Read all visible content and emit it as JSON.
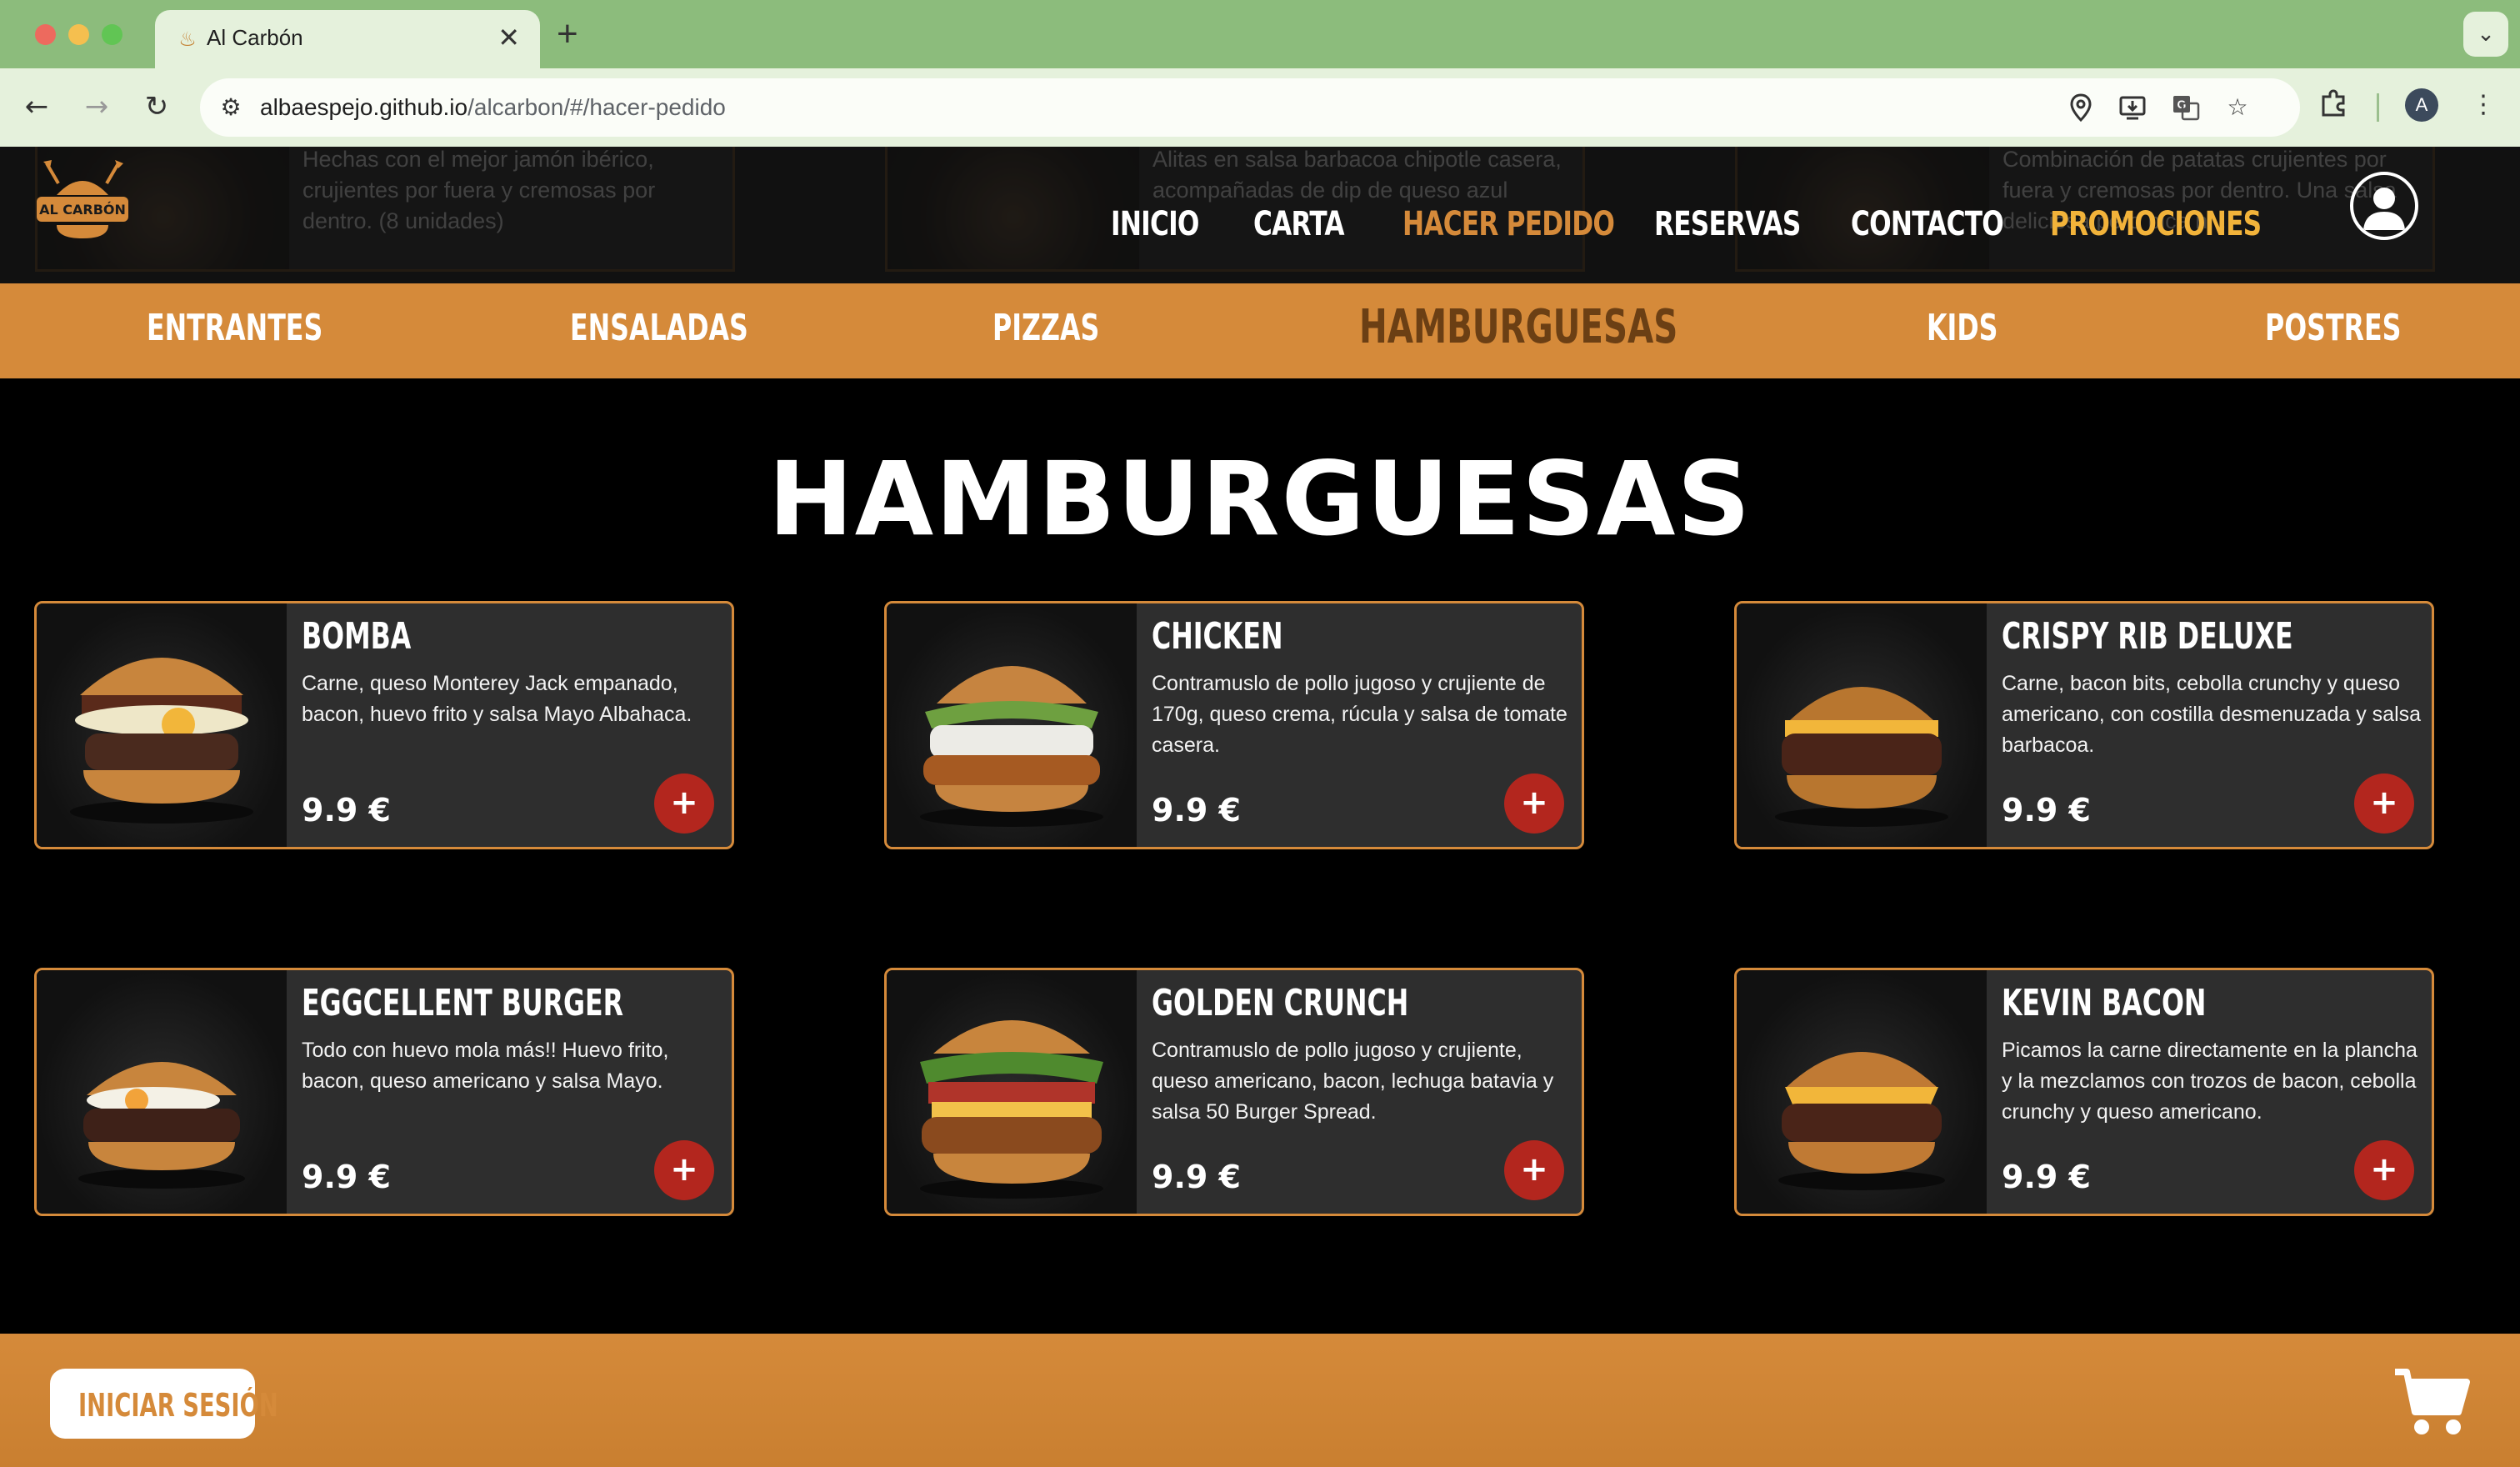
{
  "browser": {
    "tab_title": "Al Carbón",
    "url_host": "albaespejo.github.io",
    "url_path": "/alcarbon/#/hacer-pedido",
    "profile_initial": "A"
  },
  "header": {
    "ghost_cards": [
      "Hechas con el mejor jamón ibérico, crujientes por fuera y cremosas por dentro. (8 unidades)",
      "Alitas en salsa barbacoa chipotle casera, acompañadas de dip de queso azul",
      "Combinación de patatas crujientes por fuera y cremosas por dentro. Una salsa deliciosa pero pica n..."
    ],
    "nav": [
      "INICIO",
      "CARTA",
      "HACER PEDIDO",
      "RESERVAS",
      "CONTACTO",
      "PROMOCIONES"
    ],
    "logo_text": "AL CARBÓN"
  },
  "categories": [
    "ENTRANTES",
    "ENSALADAS",
    "PIZZAS",
    "HAMBURGUESAS",
    "KIDS",
    "POSTRES"
  ],
  "section_title": "HAMBURGUESAS",
  "products": [
    {
      "name": "BOMBA",
      "description": "Carne, queso Monterey Jack empanado, bacon, huevo frito y salsa Mayo Albahaca.",
      "price": "9.9 €"
    },
    {
      "name": "CHICKEN",
      "description": "Contramuslo de pollo jugoso y crujiente de 170g, queso crema, rúcula y salsa de tomate casera.",
      "price": "9.9 €"
    },
    {
      "name": "CRISPY RIB DELUXE",
      "description": "Carne, bacon bits, cebolla crunchy y queso americano, con costilla desmenuzada y salsa barbacoa.",
      "price": "9.9 €"
    },
    {
      "name": "EGGCELLENT BURGER",
      "description": "Todo con huevo mola más!! Huevo frito, bacon, queso americano y salsa Mayo.",
      "price": "9.9 €"
    },
    {
      "name": "GOLDEN CRUNCH",
      "description": "Contramuslo de pollo jugoso y crujiente, queso americano, bacon, lechuga batavia y salsa 50 Burger Spread.",
      "price": "9.9 €"
    },
    {
      "name": "KEVIN BACON",
      "description": "Picamos la carne directamente en la plancha y la mezclamos con trozos de bacon, cebolla crunchy y queso americano.",
      "price": "9.9 €"
    }
  ],
  "add_symbol": "+",
  "footer": {
    "login_label": "INICIAR SESIÓN"
  },
  "colors": {
    "accent": "#d58a3a",
    "active_category": "#6b3f14",
    "promo": "#f2b33a",
    "add_button": "#b3261e",
    "card_bg": "#2e2e2e"
  },
  "icons": [
    "location-icon",
    "install-icon",
    "translate-icon",
    "star-icon",
    "extensions-icon",
    "user-icon",
    "cart-icon"
  ]
}
